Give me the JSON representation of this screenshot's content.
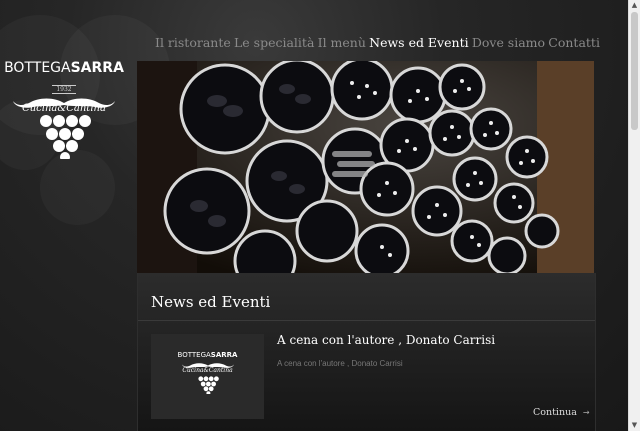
{
  "logo": {
    "brand_left": "BOTTEGA",
    "brand_right": "SARRA",
    "year": "1932",
    "tagline": "Cucina&Cantina"
  },
  "nav": {
    "items": [
      {
        "label": "Il ristorante"
      },
      {
        "label": "Le specialità"
      },
      {
        "label": "Il menù"
      },
      {
        "label": "News ed Eventi"
      },
      {
        "label": "Dove siamo"
      },
      {
        "label": "Contatti"
      }
    ]
  },
  "section": {
    "title": "News ed Eventi"
  },
  "article": {
    "title": "A cena con l'autore , Donato Carrisi",
    "excerpt": "A cena con l'autore , Donato Carrisi",
    "more_label": "Continua",
    "more_arrow": "→"
  },
  "scrollbar": {
    "up": "▲",
    "down": "▼"
  },
  "colors": {
    "background": "#1e1e1e",
    "active_nav": "#ffffff",
    "inactive_nav": "#8a8a8a"
  }
}
